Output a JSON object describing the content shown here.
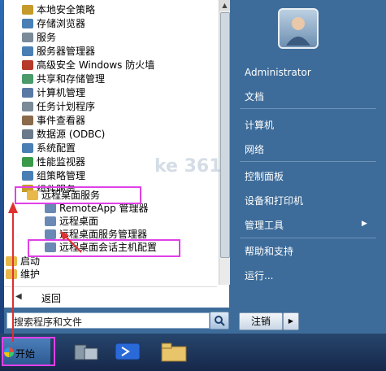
{
  "programs": [
    {
      "label": "本地安全策略",
      "color": "#c59a2a"
    },
    {
      "label": "存储浏览器",
      "color": "#4a7fb5"
    },
    {
      "label": "服务",
      "color": "#7a8a99"
    },
    {
      "label": "服务器管理器",
      "color": "#4a7fb5"
    },
    {
      "label": "高级安全 Windows 防火墙",
      "color": "#b53a2a"
    },
    {
      "label": "共享和存储管理",
      "color": "#4a9a6a"
    },
    {
      "label": "计算机管理",
      "color": "#5a7aa5"
    },
    {
      "label": "任务计划程序",
      "color": "#7a8a99"
    },
    {
      "label": "事件查看器",
      "color": "#8a6a4a"
    },
    {
      "label": "数据源 (ODBC)",
      "color": "#6a7a8a"
    },
    {
      "label": "系统配置",
      "color": "#4a7fb5"
    },
    {
      "label": "性能监视器",
      "color": "#3a9a4a"
    },
    {
      "label": "组策略管理",
      "color": "#4a7fb5"
    },
    {
      "label": "组件服务",
      "color": "#c59a2a"
    },
    {
      "label": "远程桌面服务",
      "color": "#e8b84a"
    },
    {
      "label": "RemoteApp 管理器",
      "color": "#6a8ab5"
    },
    {
      "label": "远程桌面",
      "color": "#6a8ab5"
    },
    {
      "label": "远程桌面服务管理器",
      "color": "#6a8ab5"
    },
    {
      "label": "远程桌面会话主机配置",
      "color": "#6a8ab5"
    },
    {
      "label": "启动",
      "color": "#e8b84a"
    },
    {
      "label": "维护",
      "color": "#e8b84a"
    }
  ],
  "back_label": "返回",
  "search_placeholder": "搜索程序和文件",
  "right_items": [
    "Administrator",
    "文档",
    "计算机",
    "网络",
    "控制面板",
    "设备和打印机",
    "管理工具",
    "帮助和支持",
    "运行..."
  ],
  "logout_label": "注销",
  "start_label": "开始",
  "watermark": "ke 361"
}
